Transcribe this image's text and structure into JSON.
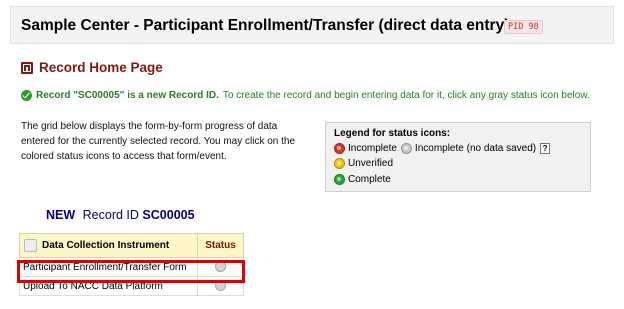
{
  "header": {
    "title": "Sample Center - Participant Enrollment/Transfer (direct data entry)",
    "pid_label": "PID 98"
  },
  "record_home": {
    "title": "Record Home Page",
    "new_record_bold": "Record \"SC00005\" is a new Record ID.",
    "new_record_text": "To create the record and begin entering data for it, click any gray status icon below.",
    "description": "The grid below displays the form-by-form progress of data entered for the currently selected record. You may click on the colored status icons to access that form/event."
  },
  "legend": {
    "title": "Legend for status icons:",
    "incomplete": "Incomplete",
    "incomplete_no_data": "Incomplete (no data saved)",
    "help": "?",
    "unverified": "Unverified",
    "complete": "Complete"
  },
  "record_heading": {
    "new": "NEW",
    "label": "Record ID",
    "record_id": "SC00005"
  },
  "grid": {
    "col_instrument": "Data Collection Instrument",
    "col_status": "Status",
    "rows": [
      {
        "instrument": "Participant Enrollment/Transfer Form"
      },
      {
        "instrument": "Upload To NACC Data Platform"
      }
    ]
  },
  "colors": {
    "accent": "#7c1c0e",
    "success_text": "#2c7a2c",
    "highlight": "#e00000",
    "header_cell": "#fcf6c9"
  }
}
